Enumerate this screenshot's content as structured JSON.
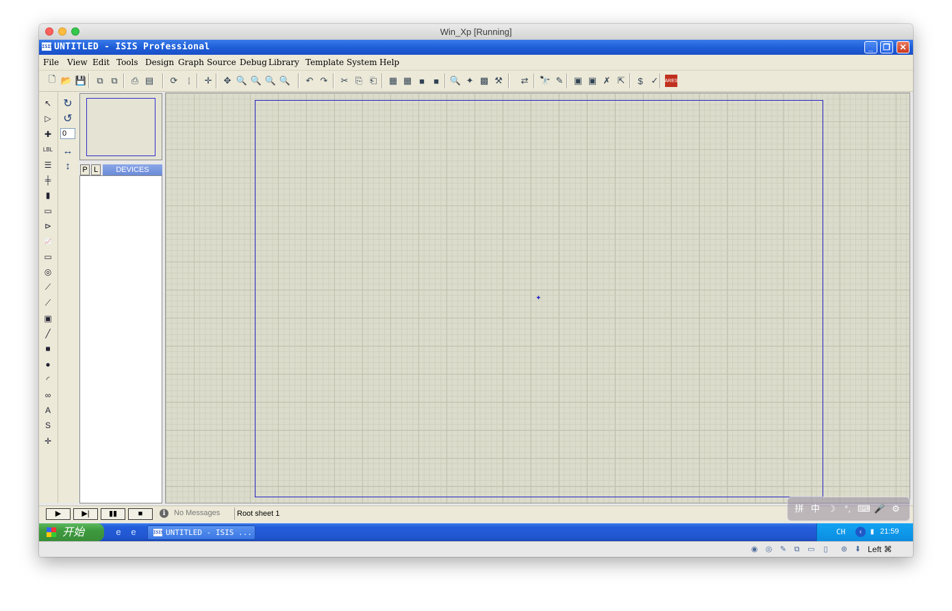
{
  "mac_window": {
    "title": "Win_Xp [Running]"
  },
  "app": {
    "title": "UNTITLED - ISIS Professional",
    "icon_text": "ISIS",
    "window_controls": {
      "minimize": "_",
      "restore": "❐",
      "close": "✕"
    }
  },
  "menu": {
    "items": [
      {
        "label": "File"
      },
      {
        "label": "View"
      },
      {
        "label": "Edit"
      },
      {
        "label": "Tools"
      },
      {
        "label": "Design"
      },
      {
        "label": "Graph"
      },
      {
        "label": "Source"
      },
      {
        "label": "Debug"
      },
      {
        "label": "Library"
      },
      {
        "label": "Template"
      },
      {
        "label": "System"
      },
      {
        "label": "Help"
      }
    ]
  },
  "toolbar": {
    "icons": [
      {
        "name": "new-icon",
        "glyph": "🗋"
      },
      {
        "name": "open-icon",
        "glyph": "📂"
      },
      {
        "name": "save-icon",
        "glyph": "💾"
      },
      {
        "name": "import-icon",
        "glyph": "⧉"
      },
      {
        "name": "export-icon",
        "glyph": "⧉"
      },
      {
        "name": "print-icon",
        "glyph": "⎙"
      },
      {
        "name": "print-area-icon",
        "glyph": "▤"
      },
      {
        "name": "refresh-icon",
        "glyph": "⟳"
      },
      {
        "name": "grid-icon",
        "glyph": "⁞"
      },
      {
        "name": "origin-icon",
        "glyph": "✛"
      },
      {
        "name": "pan-icon",
        "glyph": "✥"
      },
      {
        "name": "zoom-in-icon",
        "glyph": "🔍"
      },
      {
        "name": "zoom-out-icon",
        "glyph": "🔍"
      },
      {
        "name": "zoom-all-icon",
        "glyph": "🔍"
      },
      {
        "name": "zoom-area-icon",
        "glyph": "🔍"
      },
      {
        "name": "undo-icon",
        "glyph": "↶"
      },
      {
        "name": "redo-icon",
        "glyph": "↷"
      },
      {
        "name": "cut-icon",
        "glyph": "✂"
      },
      {
        "name": "copy-icon",
        "glyph": "⎘"
      },
      {
        "name": "paste-icon",
        "glyph": "⎗"
      },
      {
        "name": "block-copy-icon",
        "glyph": "▦"
      },
      {
        "name": "block-move-icon",
        "glyph": "▦"
      },
      {
        "name": "block-rotate-icon",
        "glyph": "■"
      },
      {
        "name": "block-delete-icon",
        "glyph": "■"
      },
      {
        "name": "pick-device-icon",
        "glyph": "🔍"
      },
      {
        "name": "make-device-icon",
        "glyph": "✦"
      },
      {
        "name": "package-icon",
        "glyph": "▩"
      },
      {
        "name": "decompose-icon",
        "glyph": "⚒"
      },
      {
        "name": "wire-autoroute-icon",
        "glyph": "⇄"
      },
      {
        "name": "search-tag-icon",
        "glyph": "🔭"
      },
      {
        "name": "property-tool-icon",
        "glyph": "✎"
      },
      {
        "name": "new-sheet-icon",
        "glyph": "▣"
      },
      {
        "name": "add-sheet-icon",
        "glyph": "▣"
      },
      {
        "name": "remove-sheet-icon",
        "glyph": "✗"
      },
      {
        "name": "goto-sheet-icon",
        "glyph": "⇱"
      },
      {
        "name": "bom-icon",
        "glyph": "$"
      },
      {
        "name": "erc-icon",
        "glyph": "✓"
      },
      {
        "name": "ares-icon",
        "glyph": "ARES"
      }
    ]
  },
  "left_tools": {
    "icons": [
      {
        "name": "selection-mode-icon",
        "glyph": "↖"
      },
      {
        "name": "component-mode-icon",
        "glyph": "▷"
      },
      {
        "name": "junction-dot-icon",
        "glyph": "✚"
      },
      {
        "name": "wire-label-icon",
        "glyph": "LBL"
      },
      {
        "name": "text-script-icon",
        "glyph": "☰"
      },
      {
        "name": "buses-icon",
        "glyph": "╪"
      },
      {
        "name": "subcircuit-icon",
        "glyph": "▮"
      },
      {
        "name": "terminals-icon",
        "glyph": "▭"
      },
      {
        "name": "device-pins-icon",
        "glyph": "⊳"
      },
      {
        "name": "graph-icon",
        "glyph": "📈"
      },
      {
        "name": "tape-recorder-icon",
        "glyph": "▭"
      },
      {
        "name": "generator-icon",
        "glyph": "◎"
      },
      {
        "name": "voltage-probe-icon",
        "glyph": "⟋"
      },
      {
        "name": "current-probe-icon",
        "glyph": "⟋"
      },
      {
        "name": "virtual-instruments-icon",
        "glyph": "▣"
      },
      {
        "name": "line-icon",
        "glyph": "╱"
      },
      {
        "name": "box-icon",
        "glyph": "■"
      },
      {
        "name": "circle-icon",
        "glyph": "●"
      },
      {
        "name": "arc-icon",
        "glyph": "◜"
      },
      {
        "name": "path-icon",
        "glyph": "∞"
      },
      {
        "name": "text-icon",
        "glyph": "A"
      },
      {
        "name": "symbol-icon",
        "glyph": "S"
      },
      {
        "name": "marker-icon",
        "glyph": "✛"
      }
    ],
    "rotate_icons": [
      {
        "name": "rotate-cw-icon",
        "glyph": "↻"
      },
      {
        "name": "rotate-ccw-icon",
        "glyph": "↺"
      }
    ],
    "rotation_value": "0",
    "mirror_icons": [
      {
        "name": "mirror-horizontal-icon",
        "glyph": "↔"
      },
      {
        "name": "mirror-vertical-icon",
        "glyph": "↕"
      }
    ]
  },
  "devices_panel": {
    "p_button": "P",
    "l_button": "L",
    "header": "DEVICES"
  },
  "status": {
    "play": "▶",
    "step": "▶|",
    "pause": "▮▮",
    "stop": "■",
    "info_icon": "i",
    "message": "No Messages",
    "sheet": "Root sheet 1"
  },
  "ime_toolbar": {
    "icons": [
      {
        "name": "ime-logo-icon",
        "glyph": "拼"
      },
      {
        "name": "ime-chinese-icon",
        "glyph": "中"
      },
      {
        "name": "ime-halfwidth-icon",
        "glyph": "☽"
      },
      {
        "name": "ime-punctuation-icon",
        "glyph": "°,"
      },
      {
        "name": "ime-keyboard-icon",
        "glyph": "⌨"
      },
      {
        "name": "ime-voice-icon",
        "glyph": "🎤"
      },
      {
        "name": "ime-settings-icon",
        "glyph": "⚙"
      }
    ]
  },
  "taskbar": {
    "start_label": "开始",
    "quick_launch": [
      {
        "name": "ie-icon",
        "glyph": "e"
      },
      {
        "name": "show-desktop-icon",
        "glyph": "e"
      }
    ],
    "task_item": "UNTITLED - ISIS ...",
    "task_item_icon": "ISIS",
    "tray_lang": "CH",
    "clock": "21:59"
  },
  "vbox_status": {
    "icons": [
      {
        "name": "hdd-icon",
        "glyph": "◉"
      },
      {
        "name": "optical-drive-icon",
        "glyph": "◎"
      },
      {
        "name": "usb-pen-icon",
        "glyph": "✎"
      },
      {
        "name": "network-icon",
        "glyph": "⧉"
      },
      {
        "name": "shared-folder-icon",
        "glyph": "▭"
      },
      {
        "name": "display-icon",
        "glyph": "▯"
      },
      {
        "name": "mouse-integration-icon",
        "glyph": "⊛"
      },
      {
        "name": "keyboard-capture-icon",
        "glyph": "⬇"
      }
    ],
    "host_key": "Left ⌘"
  }
}
